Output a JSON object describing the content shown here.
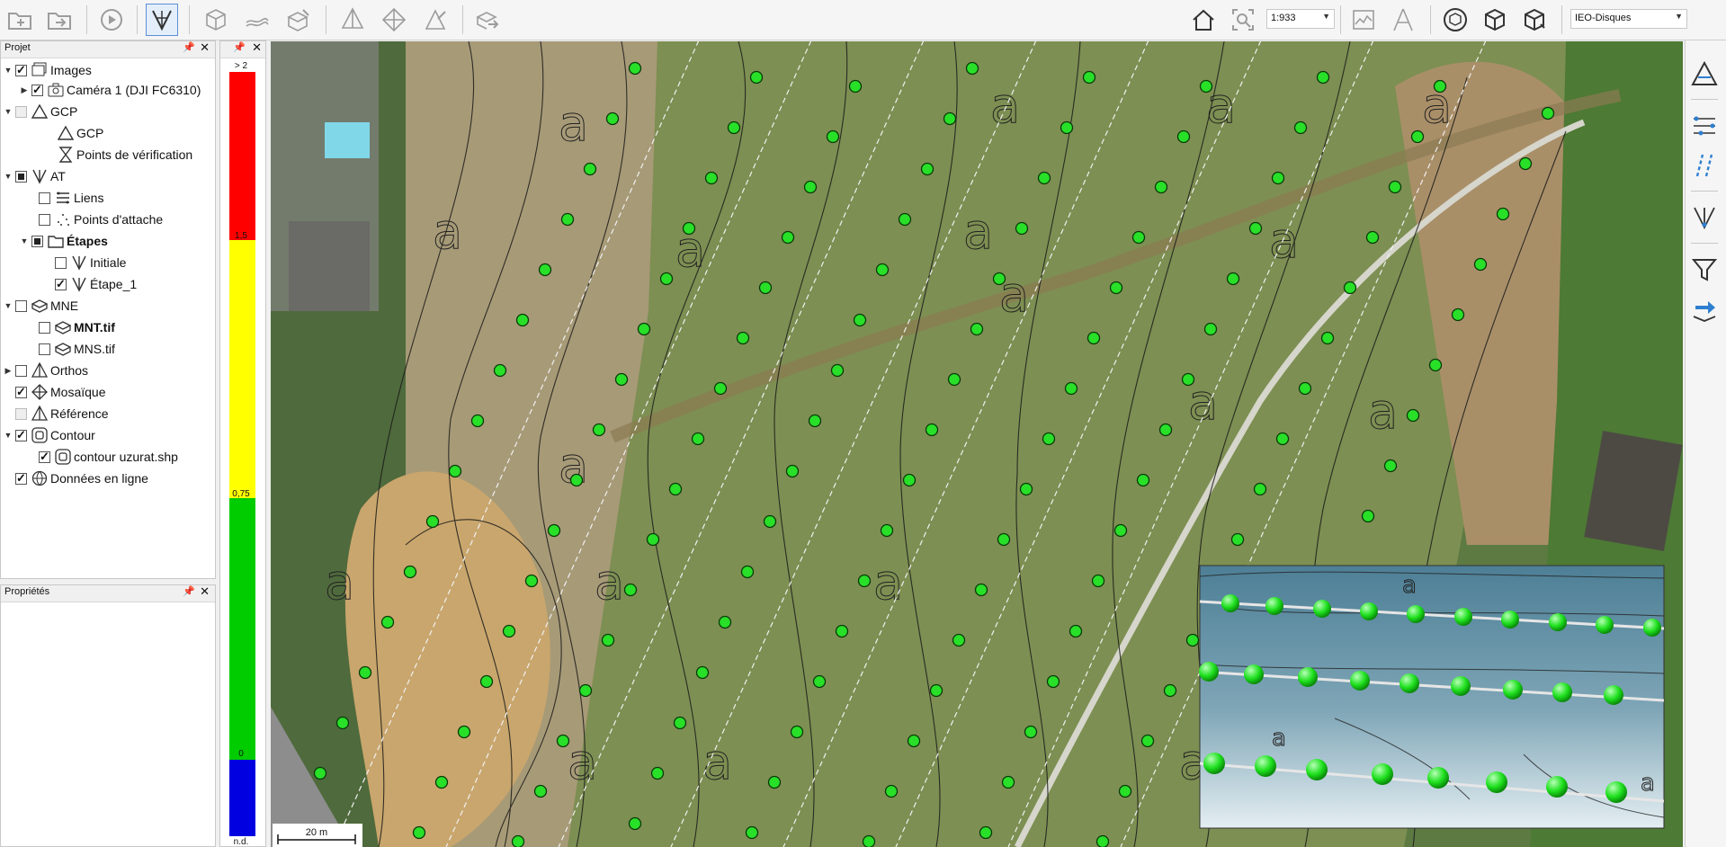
{
  "toolbar": {
    "scale": "1:933",
    "basemap": "IEO-Disques"
  },
  "project_panel": {
    "title": "Projet",
    "items": [
      {
        "label": "Images",
        "checked": true
      },
      {
        "label": "Caméra 1 (DJI FC6310)",
        "checked": true
      },
      {
        "label": "GCP"
      },
      {
        "label": "GCP"
      },
      {
        "label": "Points de vérification"
      },
      {
        "label": "AT"
      },
      {
        "label": "Liens"
      },
      {
        "label": "Points d'attache"
      },
      {
        "label": "Étapes"
      },
      {
        "label": "Initiale"
      },
      {
        "label": "Étape_1"
      },
      {
        "label": "MNE"
      },
      {
        "label": "MNT.tif"
      },
      {
        "label": "MNS.tif"
      },
      {
        "label": "Orthos"
      },
      {
        "label": "Mosaïque"
      },
      {
        "label": "Référence"
      },
      {
        "label": "Contour"
      },
      {
        "label": "contour uzurat.shp"
      },
      {
        "label": "Données en ligne"
      }
    ]
  },
  "properties_panel": {
    "title": "Propriétés"
  },
  "legend": {
    "top_label": "> 2",
    "labels": [
      "1,5",
      "0,75",
      "0",
      "n.d."
    ],
    "colors": [
      "#ff0000",
      "#ffff00",
      "#00cc00",
      "#0000e0"
    ]
  },
  "map": {
    "scale_bar_label": "20 m",
    "contour_label_glyph": "a"
  },
  "colors": {
    "accent": "#3c7fd6",
    "gcp_point": "#22dd22"
  }
}
